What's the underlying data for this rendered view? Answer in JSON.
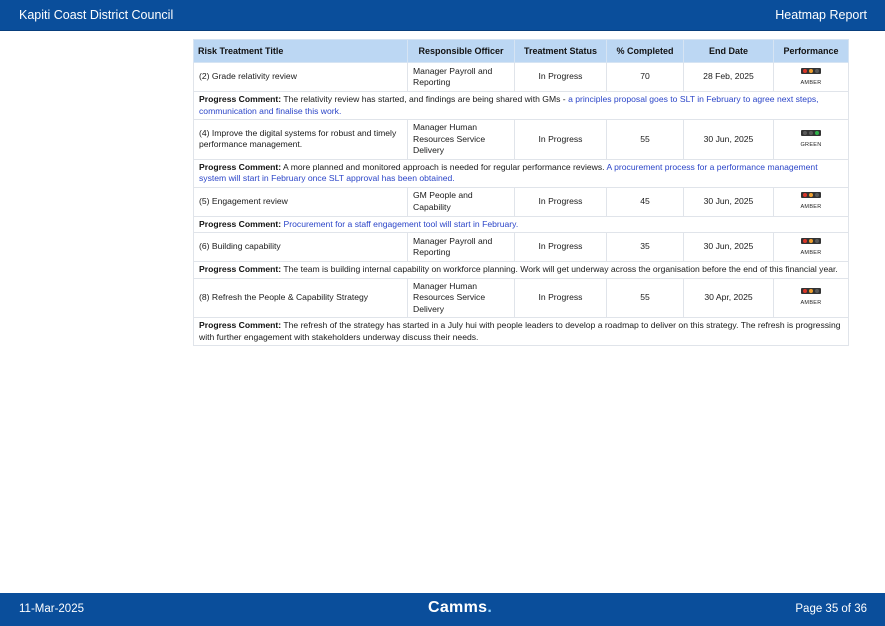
{
  "header": {
    "org": "Kapiti Coast District Council",
    "report": "Heatmap Report"
  },
  "columns": [
    "Risk Treatment Title",
    "Responsible Officer",
    "Treatment Status",
    "% Completed",
    "End Date",
    "Performance"
  ],
  "progress_label": "Progress Comment:",
  "rows": [
    {
      "title": "(2) Grade relativity review",
      "officer": "Manager Payroll and Reporting",
      "status": "In Progress",
      "completed": "70",
      "end_date": "28 Feb, 2025",
      "performance": "AMBER",
      "comment_plain": " The relativity review has started, and findings are being shared with GMs - ",
      "comment_highlight": "a principles proposal goes to SLT in February to agree next steps, communication and finalise this work."
    },
    {
      "title": "(4) Improve the digital systems for robust and timely performance management.",
      "officer": "Manager Human Resources Service Delivery",
      "status": "In Progress",
      "completed": "55",
      "end_date": "30 Jun, 2025",
      "performance": "GREEN",
      "comment_plain": " A more planned and monitored approach is needed for regular performance reviews. ",
      "comment_highlight": "A procurement process for a performance management system will start in February once SLT approval has been obtained."
    },
    {
      "title": "(5) Engagement review",
      "officer": "GM People and Capability",
      "status": "In Progress",
      "completed": "45",
      "end_date": "30 Jun, 2025",
      "performance": "AMBER",
      "comment_plain": " ",
      "comment_highlight": "Procurement for a staff engagement tool will start in February."
    },
    {
      "title": "(6) Building capability",
      "officer": "Manager Payroll and Reporting",
      "status": "In Progress",
      "completed": "35",
      "end_date": "30 Jun, 2025",
      "performance": "AMBER",
      "comment_plain": " The team is building internal capability on workforce planning. Work will get underway across the organisation before the end of this financial year.",
      "comment_highlight": ""
    },
    {
      "title": "(8) Refresh the People & Capability Strategy",
      "officer": "Manager Human Resources Service Delivery",
      "status": "In Progress",
      "completed": "55",
      "end_date": "30 Apr, 2025",
      "performance": "AMBER",
      "comment_plain": " The refresh of the strategy has started in a July hui with people leaders to develop a roadmap to deliver on this strategy. The refresh is progressing with further engagement with stakeholders underway discuss their needs.",
      "comment_highlight": ""
    }
  ],
  "footer": {
    "date": "11-Mar-2025",
    "brand": "Camms",
    "brand_dot": ".",
    "page": "Page 35 of 36"
  },
  "colors": {
    "amber": "#f0a030",
    "green": "#2fb24a",
    "red": "#d9362b",
    "off": "#5a5a5a"
  }
}
